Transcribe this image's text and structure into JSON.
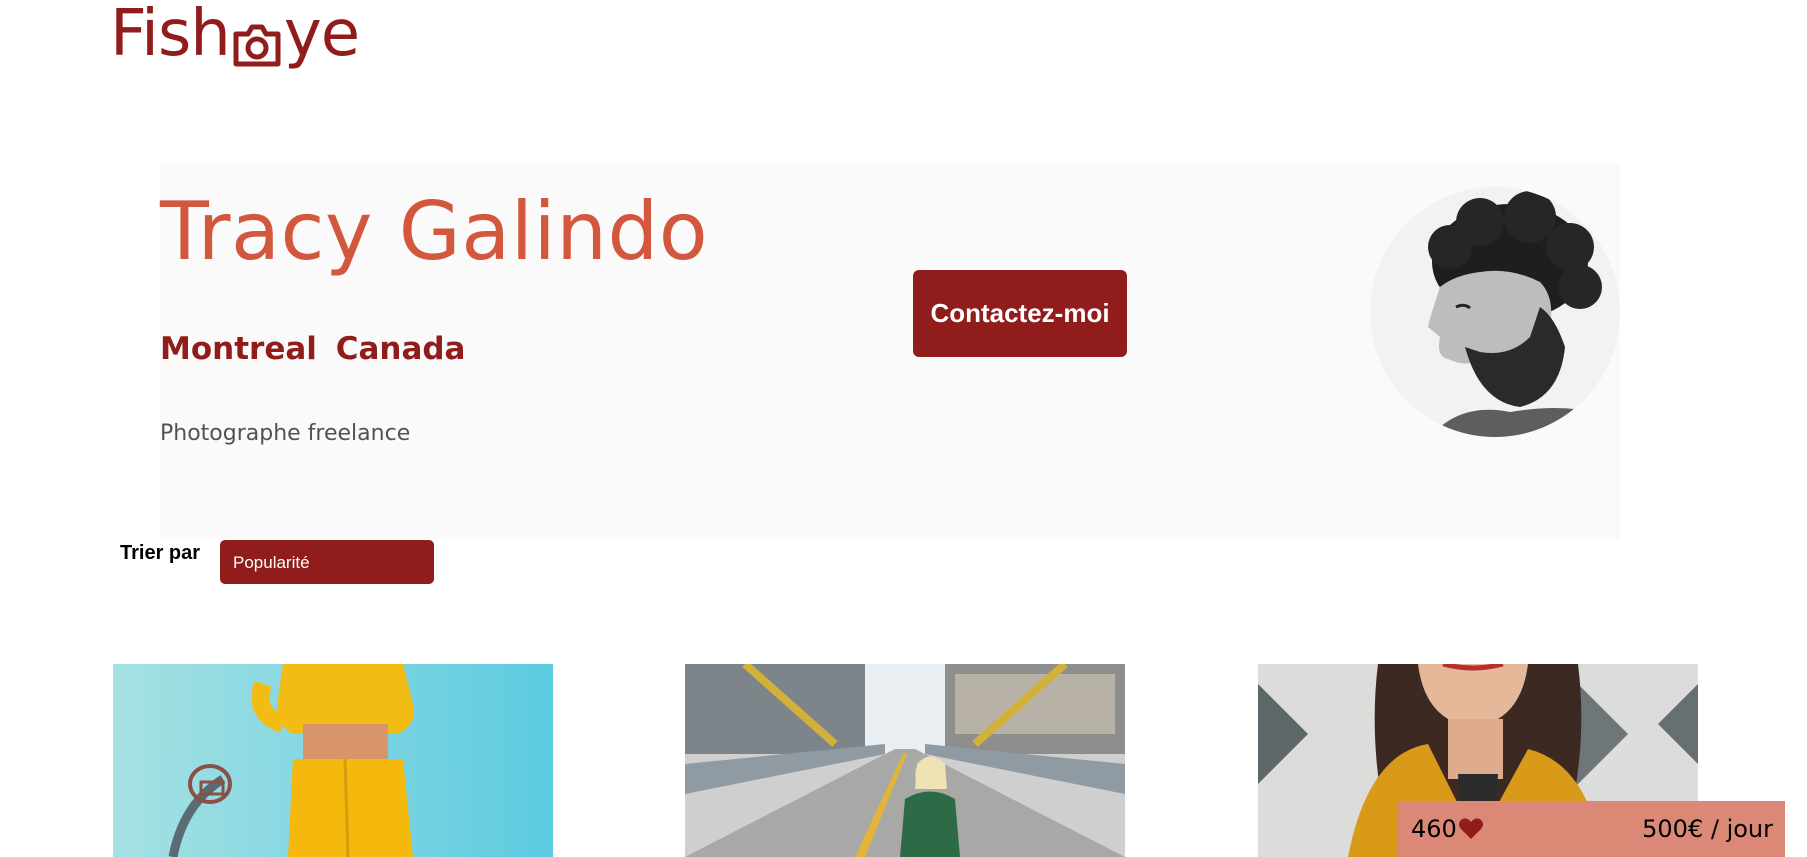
{
  "logo": {
    "text_before": "Fish",
    "text_after": "ye",
    "icon": "camera-icon"
  },
  "photographer": {
    "name": "Tracy Galindo",
    "city": "Montreal",
    "country": "Canada",
    "tagline": "Photographe freelance",
    "portrait_icon": "portrait-photo"
  },
  "contact": {
    "label": "Contactez-moi"
  },
  "sort": {
    "label": "Trier par",
    "selected": "Popularité"
  },
  "gallery": [
    {
      "subject": "yellow-outfit-basketball-photo"
    },
    {
      "subject": "bridge-street-model-photo"
    },
    {
      "subject": "yellow-jacket-portrait-photo"
    }
  ],
  "stats": {
    "likes": "460",
    "price": "500€ / jour",
    "like_icon": "heart-icon"
  },
  "colors": {
    "brand": "#901c1c",
    "name": "#d3573c",
    "stats_bg": "#db8876",
    "header_bg": "#fafafa"
  }
}
